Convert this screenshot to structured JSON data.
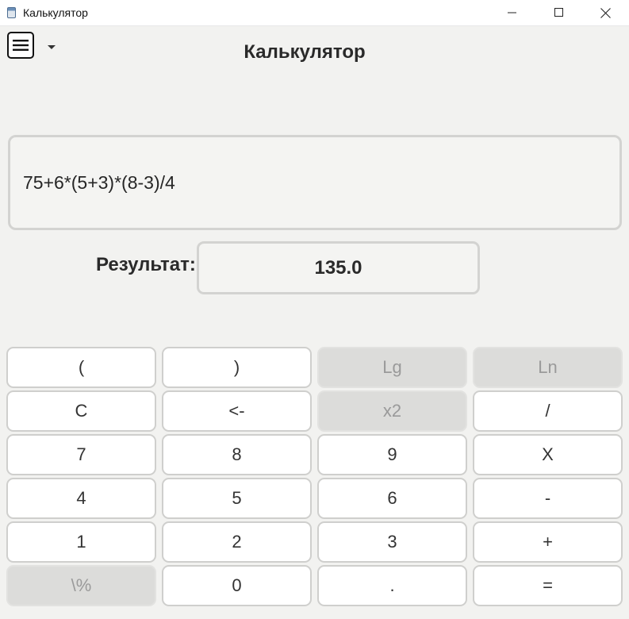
{
  "window": {
    "title": "Калькулятор",
    "controls": [
      "minimize-icon",
      "maximize-icon",
      "close-icon"
    ]
  },
  "toolbar": {
    "menu_icon": "hamburger-menu-icon",
    "dropdown_icon": "chevron-down-icon"
  },
  "header": {
    "title": "Калькулятор"
  },
  "display": {
    "expression": "75+6*(5+3)*(8-3)/4",
    "result_label": "Результат:",
    "result_value": "135.0"
  },
  "keypad": {
    "keys": [
      {
        "label": "(",
        "enabled": true
      },
      {
        "label": ")",
        "enabled": true
      },
      {
        "label": "Lg",
        "enabled": false
      },
      {
        "label": "Ln",
        "enabled": false
      },
      {
        "label": "C",
        "enabled": true
      },
      {
        "label": "<-",
        "enabled": true
      },
      {
        "label": "x2",
        "enabled": false
      },
      {
        "label": "/",
        "enabled": true
      },
      {
        "label": "7",
        "enabled": true
      },
      {
        "label": "8",
        "enabled": true
      },
      {
        "label": "9",
        "enabled": true
      },
      {
        "label": "X",
        "enabled": true
      },
      {
        "label": "4",
        "enabled": true
      },
      {
        "label": "5",
        "enabled": true
      },
      {
        "label": "6",
        "enabled": true
      },
      {
        "label": "-",
        "enabled": true
      },
      {
        "label": "1",
        "enabled": true
      },
      {
        "label": "2",
        "enabled": true
      },
      {
        "label": "3",
        "enabled": true
      },
      {
        "label": "+",
        "enabled": true
      },
      {
        "label": "\\%",
        "enabled": false
      },
      {
        "label": "0",
        "enabled": true
      },
      {
        "label": ".",
        "enabled": true
      },
      {
        "label": "=",
        "enabled": true
      }
    ]
  },
  "colors": {
    "background": "#f2f2f0",
    "key_background": "#ffffff",
    "key_disabled_background": "#dcdcda",
    "border": "#d3d3d1"
  }
}
